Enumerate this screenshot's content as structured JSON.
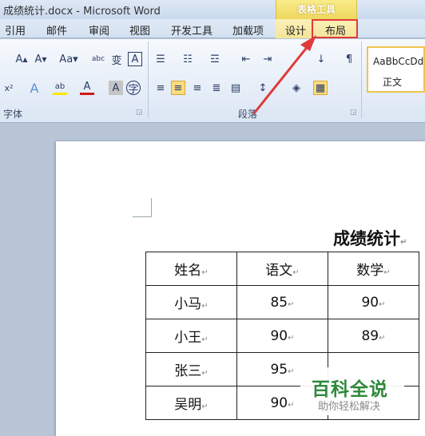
{
  "window": {
    "title": "成绩统计.docx - Microsoft Word",
    "context_group": "表格工具"
  },
  "tabs": [
    {
      "label": "引用"
    },
    {
      "label": "邮件"
    },
    {
      "label": "审阅"
    },
    {
      "label": "视图"
    },
    {
      "label": "开发工具"
    },
    {
      "label": "加载项"
    },
    {
      "label": "设计"
    },
    {
      "label": "布局"
    }
  ],
  "ribbon": {
    "font_group_label": "字体",
    "paragraph_group_label": "段落",
    "style_sample": "AaBbCcDd",
    "style_name": "正文",
    "icons_row1": [
      "A^",
      "A˅",
      "Aa",
      "abc",
      "变",
      "A",
      "list-bullets",
      "list-numbers",
      "list-multi",
      "indent-decrease",
      "indent-increase",
      "sort",
      "show-marks"
    ],
    "icons_row2": [
      "x²",
      "A",
      "ab",
      "A",
      "A",
      "字",
      "align-left",
      "align-center",
      "align-right",
      "justify",
      "distribute",
      "line-spacing",
      "shading",
      "borders"
    ]
  },
  "document": {
    "title": "成绩统计",
    "paragraph_mark": "↵",
    "table": {
      "headers": [
        "姓名",
        "语文",
        "数学"
      ],
      "rows": [
        [
          "小马",
          "85",
          "90"
        ],
        [
          "小王",
          "90",
          "89"
        ],
        [
          "张三",
          "95",
          ""
        ],
        [
          "吴明",
          "90",
          ""
        ]
      ]
    }
  },
  "watermark": {
    "title": "百科全说",
    "subtitle": "助你轻松解决"
  },
  "colors": {
    "highlight_box": "#e03a3a",
    "arrow": "#e03a3a",
    "context_tab": "#f4e49a"
  }
}
